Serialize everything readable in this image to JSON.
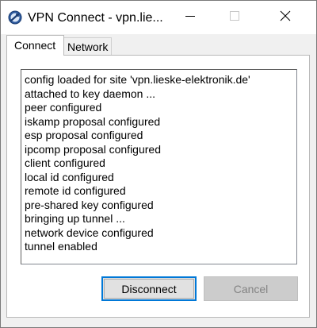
{
  "window": {
    "title": "VPN Connect - vpn.lie..."
  },
  "titlebar": {
    "icons": {
      "app": "vpn-app-icon",
      "minimize": "minimize-icon",
      "maximize": "maximize-icon",
      "close": "close-icon"
    }
  },
  "tabs": [
    {
      "label": "Connect",
      "active": true
    },
    {
      "label": "Network",
      "active": false
    }
  ],
  "log": {
    "lines": [
      "config loaded for site 'vpn.lieske-elektronik.de'",
      "attached to key daemon ...",
      "peer configured",
      "iskamp proposal configured",
      "esp proposal configured",
      "ipcomp proposal configured",
      "client configured",
      "local id configured",
      "remote id configured",
      "pre-shared key configured",
      "bringing up tunnel ...",
      "network device configured",
      "tunnel enabled"
    ]
  },
  "buttons": {
    "disconnect": "Disconnect",
    "cancel": "Cancel"
  },
  "colors": {
    "focus_border": "#0078d7",
    "disabled_text": "#838383"
  }
}
